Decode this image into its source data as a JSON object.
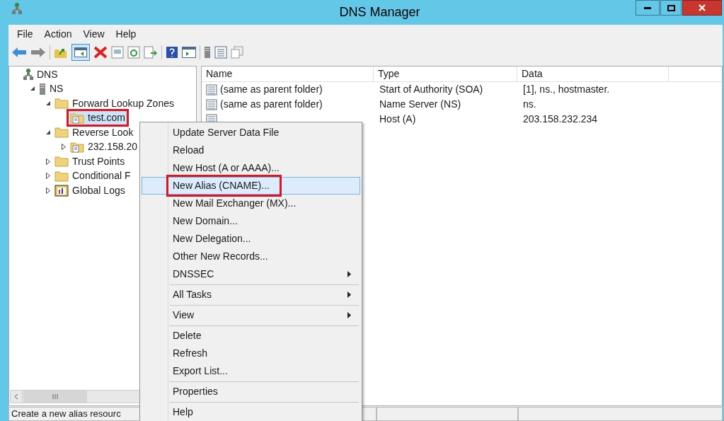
{
  "window": {
    "title": "DNS Manager"
  },
  "menu_bar": [
    "File",
    "Action",
    "View",
    "Help"
  ],
  "tree": [
    {
      "label": "DNS",
      "kind": "dns",
      "expandable": false,
      "selected": false,
      "highlighted": false,
      "children": [
        {
          "label": "NS",
          "kind": "server",
          "expandable": true,
          "expanded": true,
          "selected": false,
          "highlighted": false,
          "children": [
            {
              "label": "Forward Lookup Zones",
              "kind": "folder",
              "expandable": true,
              "expanded": true,
              "selected": false,
              "highlighted": false,
              "children": [
                {
                  "label": "test.com",
                  "kind": "zone",
                  "expandable": false,
                  "selected": true,
                  "highlighted": true
                }
              ]
            },
            {
              "label": "Reverse Look",
              "kind": "folder",
              "expandable": true,
              "expanded": true,
              "selected": false,
              "highlighted": false,
              "children": [
                {
                  "label": "232.158.20",
                  "kind": "zone",
                  "expandable": true,
                  "expanded": false,
                  "selected": false,
                  "highlighted": false
                }
              ]
            },
            {
              "label": "Trust Points",
              "kind": "folder",
              "expandable": true,
              "expanded": false,
              "selected": false,
              "highlighted": false
            },
            {
              "label": "Conditional F",
              "kind": "folder",
              "expandable": true,
              "expanded": false,
              "selected": false,
              "highlighted": false
            },
            {
              "label": "Global Logs",
              "kind": "logs",
              "expandable": true,
              "expanded": false,
              "selected": false,
              "highlighted": false
            }
          ]
        }
      ]
    }
  ],
  "table": {
    "columns": [
      "Name",
      "Type",
      "Data"
    ],
    "rows": [
      [
        "(same as parent folder)",
        "Start of Authority (SOA)",
        "[1], ns., hostmaster."
      ],
      [
        "(same as parent folder)",
        "Name Server (NS)",
        "ns."
      ],
      [
        null,
        "Host (A)",
        "203.158.232.234"
      ]
    ]
  },
  "context_menu": [
    {
      "kind": "item",
      "label": "Update Server Data File",
      "submenu": false,
      "selected": false,
      "highlighted": false
    },
    {
      "kind": "item",
      "label": "Reload",
      "submenu": false,
      "selected": false,
      "highlighted": false
    },
    {
      "kind": "item",
      "label": "New Host (A or AAAA)...",
      "submenu": false,
      "selected": false,
      "highlighted": false
    },
    {
      "kind": "item",
      "label": "New Alias (CNAME)...",
      "submenu": false,
      "selected": true,
      "highlighted": true
    },
    {
      "kind": "item",
      "label": "New Mail Exchanger (MX)...",
      "submenu": false,
      "selected": false,
      "highlighted": false
    },
    {
      "kind": "item",
      "label": "New Domain...",
      "submenu": false,
      "selected": false,
      "highlighted": false
    },
    {
      "kind": "item",
      "label": "New Delegation...",
      "submenu": false,
      "selected": false,
      "highlighted": false
    },
    {
      "kind": "item",
      "label": "Other New Records...",
      "submenu": false,
      "selected": false,
      "highlighted": false
    },
    {
      "kind": "item",
      "label": "DNSSEC",
      "submenu": true,
      "selected": false,
      "highlighted": false
    },
    {
      "kind": "separator"
    },
    {
      "kind": "item",
      "label": "All Tasks",
      "submenu": true,
      "selected": false,
      "highlighted": false
    },
    {
      "kind": "separator"
    },
    {
      "kind": "item",
      "label": "View",
      "submenu": true,
      "selected": false,
      "highlighted": false
    },
    {
      "kind": "separator"
    },
    {
      "kind": "item",
      "label": "Delete",
      "submenu": false,
      "selected": false,
      "highlighted": false
    },
    {
      "kind": "item",
      "label": "Refresh",
      "submenu": false,
      "selected": false,
      "highlighted": false
    },
    {
      "kind": "item",
      "label": "Export List...",
      "submenu": false,
      "selected": false,
      "highlighted": false
    },
    {
      "kind": "separator"
    },
    {
      "kind": "item",
      "label": "Properties",
      "submenu": false,
      "selected": false,
      "highlighted": false
    },
    {
      "kind": "separator"
    },
    {
      "kind": "item",
      "label": "Help",
      "submenu": false,
      "selected": false,
      "highlighted": false
    }
  ],
  "status_bar": "Create a new alias resourc"
}
